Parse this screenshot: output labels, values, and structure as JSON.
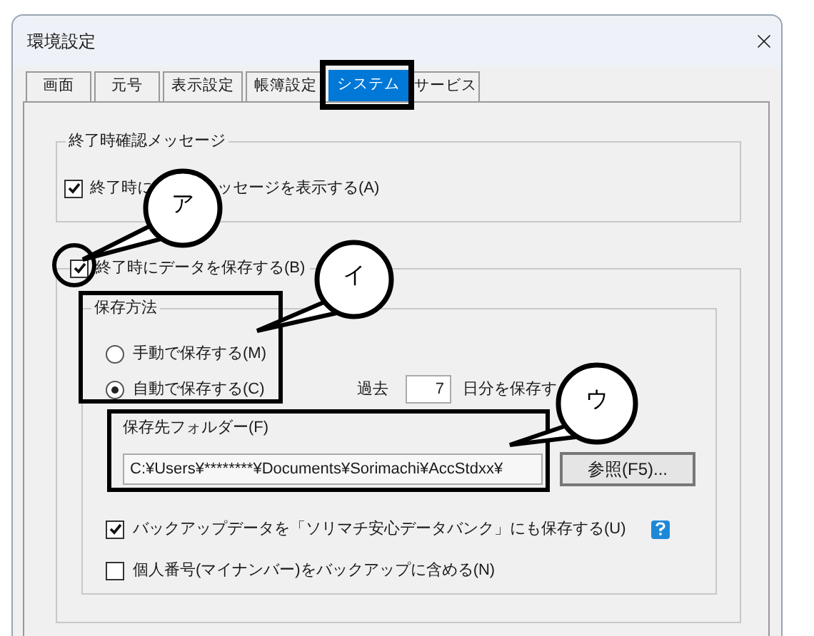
{
  "window": {
    "title": "環境設定"
  },
  "tabs": [
    {
      "label": "画面",
      "selected": false
    },
    {
      "label": "元号",
      "selected": false
    },
    {
      "label": "表示設定",
      "selected": false
    },
    {
      "label": "帳簿設定",
      "selected": false
    },
    {
      "label": "システム",
      "selected": true
    },
    {
      "label": "サービス",
      "selected": false
    }
  ],
  "exit_confirm_group": {
    "legend": "終了時確認メッセージ",
    "checkbox": {
      "label_parts": [
        "終了時に",
        "ッセージを表示する(A)"
      ],
      "checked": true
    }
  },
  "save_on_exit": {
    "label": "終了時にデータを保存する(B)",
    "checked": true
  },
  "save_method": {
    "legend": "保存方法",
    "options": [
      {
        "label": "手動で保存する(M)",
        "selected": false
      },
      {
        "label": "自動で保存する(C)",
        "selected": true
      }
    ],
    "past_label": "過去",
    "days": "7",
    "days_suffix": "日分を保存す"
  },
  "folder": {
    "label": "保存先フォルダー(F)",
    "path": "C:¥Users¥********¥Documents¥Sorimachi¥AccStdxx¥",
    "browse_button": "参照(F5)..."
  },
  "options": [
    {
      "label": "バックアップデータを「ソリマチ安心データバンク」にも保存する(U)",
      "checked": true,
      "help": true
    },
    {
      "label": "個人番号(マイナンバー)をバックアップに含める(N)",
      "checked": false,
      "help": false
    }
  ],
  "callouts": [
    {
      "label": "ア"
    },
    {
      "label": "イ"
    },
    {
      "label": "ウ"
    }
  ]
}
